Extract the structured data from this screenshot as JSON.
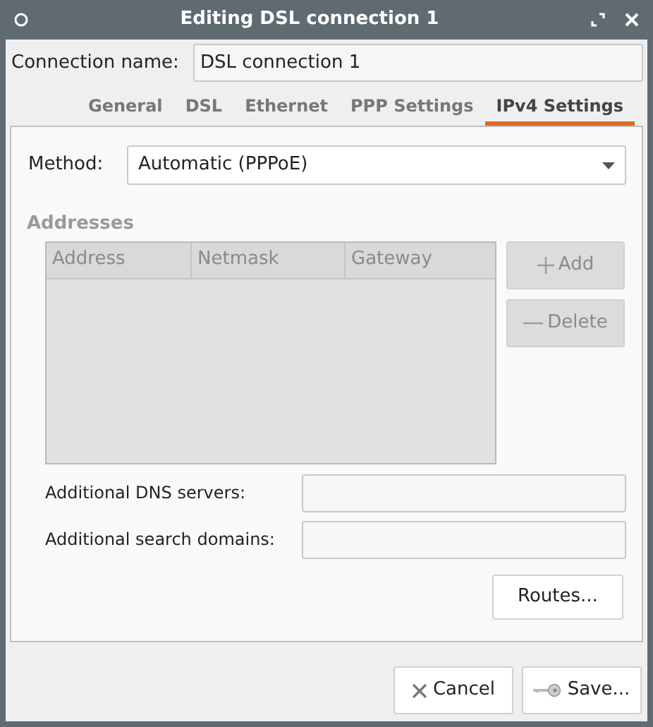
{
  "window": {
    "title": "Editing DSL connection 1"
  },
  "connection_name": {
    "label": "Connection name:",
    "value": "DSL connection 1"
  },
  "tabs": [
    {
      "label": "General",
      "selected": false
    },
    {
      "label": "DSL",
      "selected": false
    },
    {
      "label": "Ethernet",
      "selected": false
    },
    {
      "label": "PPP Settings",
      "selected": false
    },
    {
      "label": "IPv4 Settings",
      "selected": true
    }
  ],
  "method": {
    "label": "Method:",
    "value": "Automatic (PPPoE)"
  },
  "addresses": {
    "title": "Addresses",
    "disabled": true,
    "columns": [
      "Address",
      "Netmask",
      "Gateway"
    ],
    "buttons": [
      {
        "kind": "add",
        "label": "Add",
        "disabled": true
      },
      {
        "kind": "delete",
        "label": "Delete",
        "disabled": true
      }
    ]
  },
  "fields": [
    {
      "label": "Additional DNS servers:"
    },
    {
      "label": "Additional search domains:"
    }
  ],
  "routes_button": "Routes...",
  "footer_buttons": [
    {
      "kind": "cancel",
      "label": "Cancel"
    },
    {
      "kind": "save",
      "label": "Save..."
    }
  ]
}
